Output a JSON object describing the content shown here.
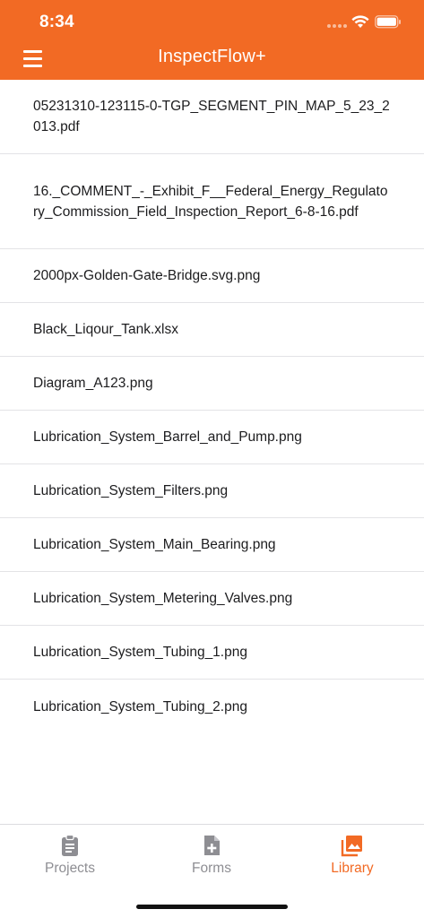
{
  "status_bar": {
    "time": "8:34"
  },
  "header": {
    "title": "InspectFlow+",
    "menu_icon": "hamburger-menu-icon"
  },
  "files": [
    {
      "name": "05231310-123115-0-TGP_SEGMENT_PIN_MAP_5_23_2013.pdf"
    },
    {
      "name": "16._COMMENT_-_Exhibit_F__Federal_Energy_Regulatory_Commission_Field_Inspection_Report_6-8-16.pdf"
    },
    {
      "name": "2000px-Golden-Gate-Bridge.svg.png"
    },
    {
      "name": "Black_Liqour_Tank.xlsx"
    },
    {
      "name": "Diagram_A123.png"
    },
    {
      "name": "Lubrication_System_Barrel_and_Pump.png"
    },
    {
      "name": "Lubrication_System_Filters.png"
    },
    {
      "name": "Lubrication_System_Main_Bearing.png"
    },
    {
      "name": "Lubrication_System_Metering_Valves.png"
    },
    {
      "name": "Lubrication_System_Tubing_1.png"
    },
    {
      "name": "Lubrication_System_Tubing_2.png"
    }
  ],
  "tabs": [
    {
      "label": "Projects",
      "icon": "clipboard-icon",
      "active": false
    },
    {
      "label": "Forms",
      "icon": "add-document-icon",
      "active": false
    },
    {
      "label": "Library",
      "icon": "photo-library-icon",
      "active": true
    }
  ],
  "colors": {
    "accent": "#f26a24",
    "inactive": "#8e8e93"
  }
}
